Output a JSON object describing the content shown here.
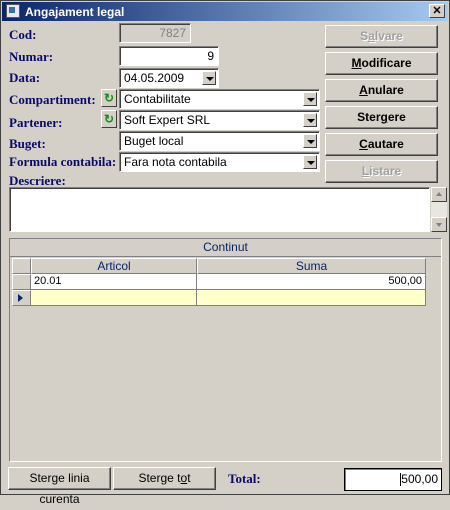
{
  "window": {
    "title": "Angajament legal",
    "close_glyph": "✕"
  },
  "labels": {
    "cod": "Cod:",
    "numar": "Numar:",
    "data": "Data:",
    "compartiment": "Compartiment:",
    "partener": "Partener:",
    "buget": "Buget:",
    "formula": "Formula contabila:",
    "descriere": "Descriere:"
  },
  "fields": {
    "cod": "7827",
    "numar": "9",
    "data": "04.05.2009",
    "compartiment": "Contabilitate",
    "partener": "Soft Expert SRL",
    "buget": "Buget local",
    "formula": "Fara nota contabila",
    "descriere": ""
  },
  "buttons": {
    "salvare": {
      "pre": "S",
      "ul": "a",
      "post": "lvare",
      "enabled": false
    },
    "modificare": {
      "pre": "",
      "ul": "M",
      "post": "odificare",
      "enabled": true
    },
    "anulare": {
      "pre": "",
      "ul": "A",
      "post": "nulare",
      "enabled": true
    },
    "stergere": {
      "pre": "Ster",
      "ul": "g",
      "post": "ere",
      "enabled": true
    },
    "cautare": {
      "pre": "",
      "ul": "C",
      "post": "autare",
      "enabled": true
    },
    "listare": {
      "pre": "",
      "ul": "L",
      "post": "istare",
      "enabled": false
    }
  },
  "continut": {
    "title": "Continut",
    "columns": [
      "Articol",
      "Suma"
    ],
    "rows": [
      {
        "articol": "20.01",
        "suma": "500,00"
      },
      {
        "articol": "",
        "suma": ""
      }
    ]
  },
  "bottom": {
    "sterge_linia": "Sterge linia curenta",
    "sterge_tot_pre": "Sterge t",
    "sterge_tot_ul": "o",
    "sterge_tot_post": "t",
    "total_label": "Total:",
    "total_pre": "",
    "total_post": "500,00"
  },
  "icons": {
    "refresh": "refresh-icon",
    "dropdown": "chevron-down-icon",
    "row_indicator": "row-pointer-icon"
  }
}
